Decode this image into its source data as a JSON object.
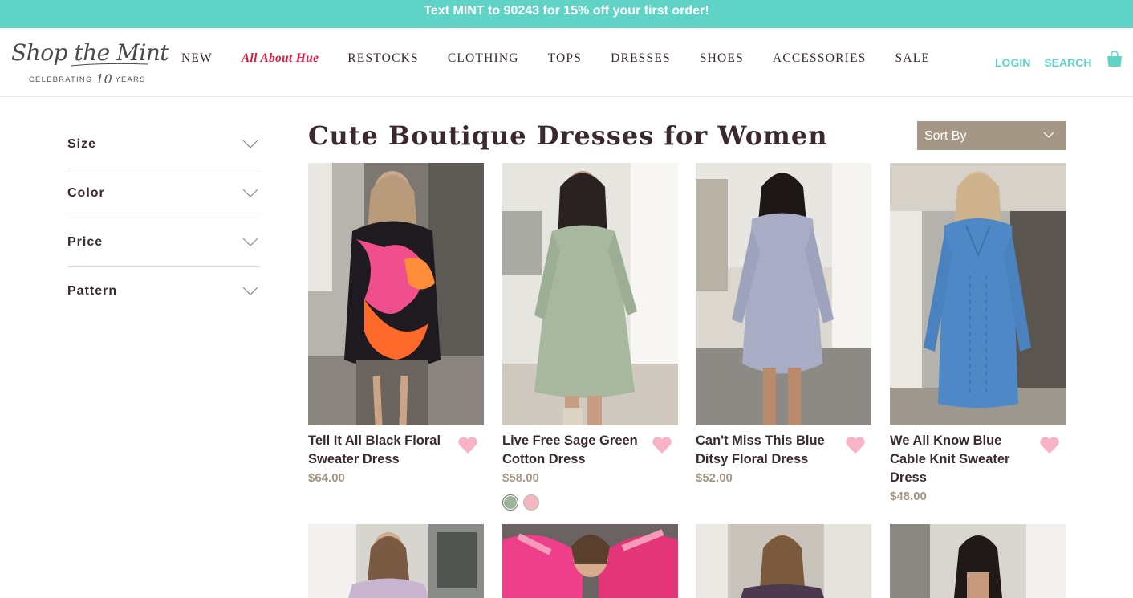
{
  "promo": {
    "text": "Text MINT to 90243 for 15% off your first order!"
  },
  "logo": {
    "script": "Shop the Mint",
    "sub_prefix": "CELEBRATING",
    "sub_number": "10",
    "sub_suffix": "YEARS"
  },
  "nav": {
    "items": [
      {
        "label": "NEW"
      },
      {
        "label": "All About Hue",
        "featured": true
      },
      {
        "label": "RESTOCKS"
      },
      {
        "label": "CLOTHING"
      },
      {
        "label": "TOPS"
      },
      {
        "label": "DRESSES"
      },
      {
        "label": "SHOES"
      },
      {
        "label": "ACCESSORIES"
      },
      {
        "label": "SALE"
      }
    ]
  },
  "utility": {
    "login": "LOGIN",
    "search": "SEARCH",
    "bag_icon": "shopping-bag-icon"
  },
  "filters": [
    {
      "label": "Size"
    },
    {
      "label": "Color"
    },
    {
      "label": "Price"
    },
    {
      "label": "Pattern"
    }
  ],
  "page": {
    "title": "Cute Boutique Dresses for Women"
  },
  "sort": {
    "label": "Sort By"
  },
  "products": [
    {
      "name": "Tell It All Black Floral Sweater Dress",
      "price": "$64.00"
    },
    {
      "name": "Live Free Sage Green Cotton Dress",
      "price": "$58.00",
      "swatches": [
        "#9db39a",
        "#f4b6c0"
      ]
    },
    {
      "name": "Can't Miss This Blue Ditsy Floral Dress",
      "price": "$52.00"
    },
    {
      "name": "We All Know Blue Cable Knit Sweater Dress",
      "price": "$48.00"
    }
  ],
  "colors": {
    "mint": "#5ed3c6",
    "brand_red": "#e2163d",
    "sort_bg": "#a59785",
    "heart": "#f8b3c6",
    "text": "#3a2a2e"
  }
}
